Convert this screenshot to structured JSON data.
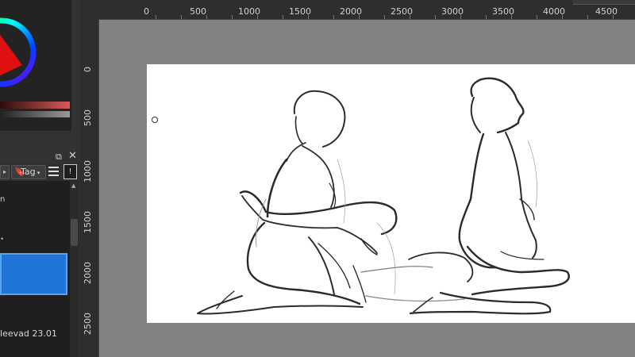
{
  "ruler": {
    "horizontal": [
      "0",
      "500",
      "1000",
      "1500",
      "2000",
      "2500",
      "3000",
      "3500",
      "4000",
      "4500"
    ],
    "vertical": [
      "0",
      "500",
      "1000",
      "1500",
      "2000",
      "2500"
    ]
  },
  "docker": {
    "tag_label": "Tag",
    "info_label": "!",
    "item_1_text": "n",
    "item_dot": "•",
    "item_2_text": "leevad 23.01"
  },
  "icons": {
    "float": "float-icon",
    "close": "close-icon",
    "menu": "hamburger-menu-icon",
    "bookmark": "bookmark-icon"
  },
  "colors": {
    "selected": "#1f74d6",
    "canvas_bg": "#828282",
    "paper": "#ffffff"
  }
}
